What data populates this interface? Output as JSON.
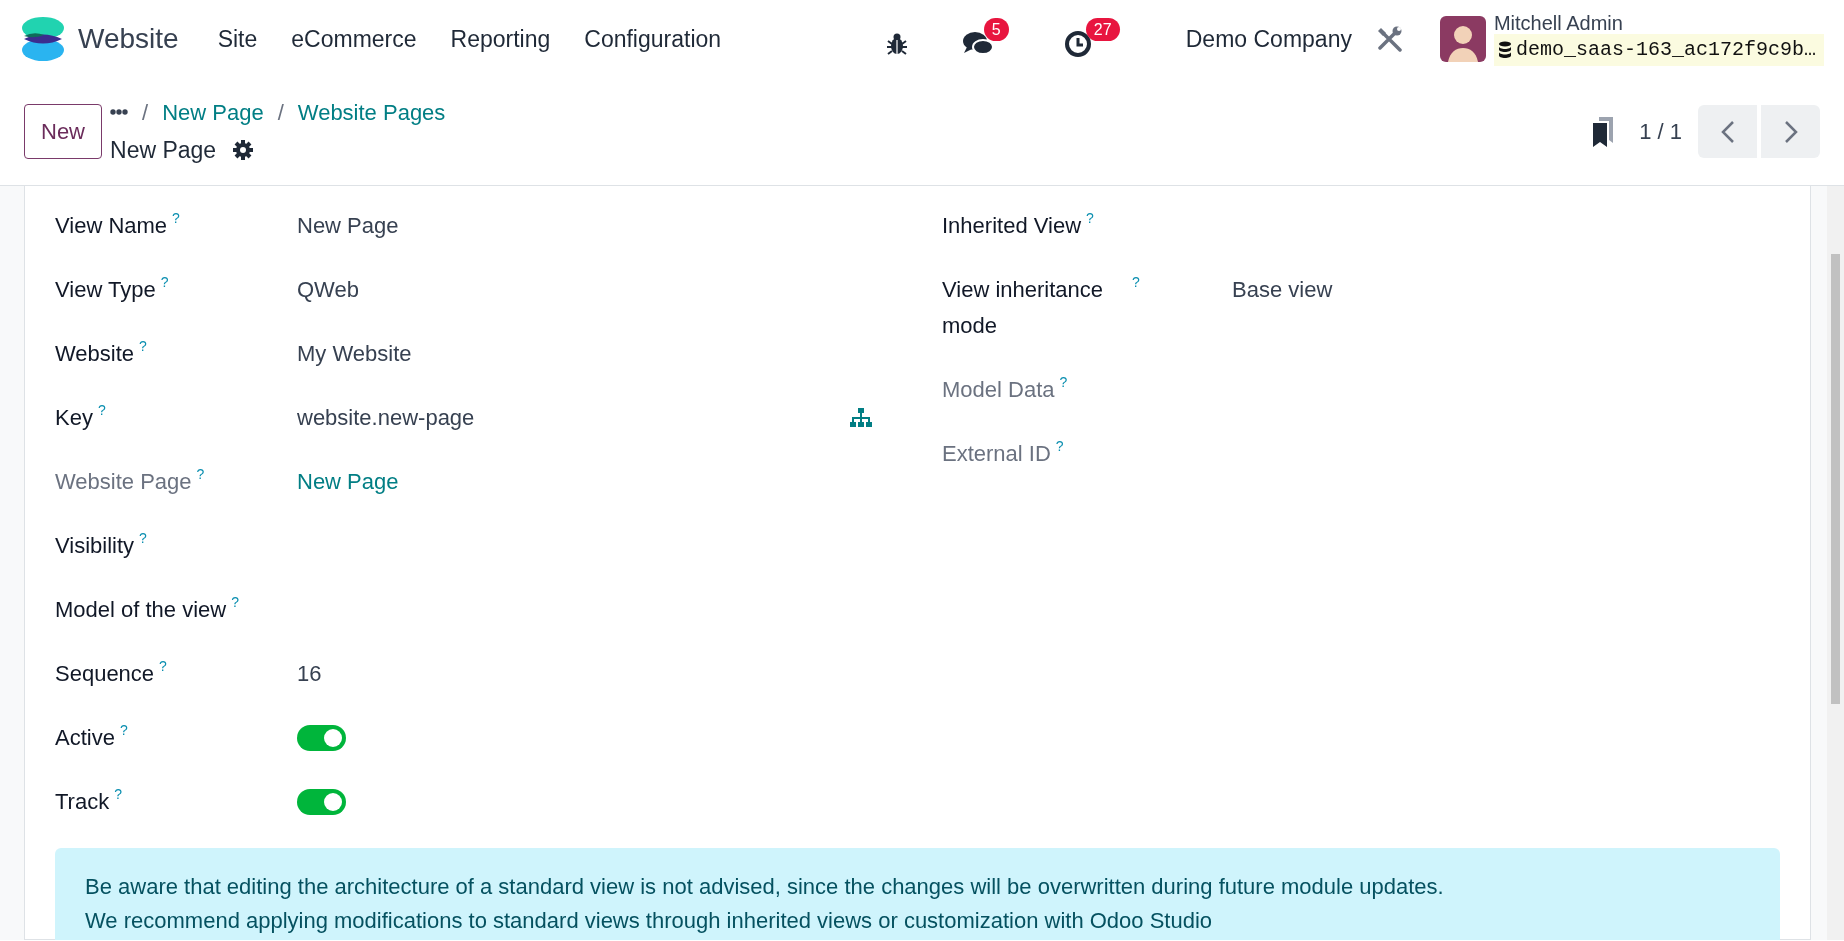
{
  "navbar": {
    "app_name": "Website",
    "menu": [
      "Site",
      "eCommerce",
      "Reporting",
      "Configuration"
    ],
    "messages_badge": "5",
    "activities_badge": "27",
    "company": "Demo Company",
    "user": {
      "name": "Mitchell Admin",
      "database": "demo_saas-163_ac172f9c9b…"
    }
  },
  "control_panel": {
    "new_button": "New",
    "breadcrumb_separator": "/",
    "breadcrumbs": [
      "New Page",
      "Website Pages"
    ],
    "title": "New Page",
    "pager": "1 / 1"
  },
  "form": {
    "left_fields": [
      {
        "label": "View Name",
        "help": "?",
        "muted": false,
        "kind": "text",
        "value": "New Page"
      },
      {
        "label": "View Type",
        "help": "?",
        "muted": false,
        "kind": "text",
        "value": "QWeb"
      },
      {
        "label": "Website",
        "help": "?",
        "muted": false,
        "kind": "text",
        "value": "My Website"
      },
      {
        "label": "Key",
        "help": "?",
        "muted": false,
        "kind": "text",
        "value": "website.new-page",
        "action_icon": true
      },
      {
        "label": "Website Page",
        "help": "?",
        "muted": true,
        "kind": "link",
        "value": "New Page"
      },
      {
        "label": "Visibility",
        "help": "?",
        "muted": false,
        "kind": "empty"
      },
      {
        "label": "Model of the view",
        "help": "?",
        "muted": false,
        "kind": "empty"
      },
      {
        "label": "Sequence",
        "help": "?",
        "muted": false,
        "kind": "text",
        "value": "16"
      },
      {
        "label": "Active",
        "help": "?",
        "muted": false,
        "kind": "toggle",
        "on": true
      },
      {
        "label": "Track",
        "help": "?",
        "muted": false,
        "kind": "toggle",
        "on": true
      }
    ],
    "right_fields": [
      {
        "label": "Inherited View",
        "help": "?",
        "muted": false,
        "kind": "empty"
      },
      {
        "label": "View inheritance mode",
        "help": "?",
        "muted": false,
        "kind": "text",
        "value": "Base view"
      },
      {
        "label": "Model Data",
        "help": "?",
        "muted": true,
        "kind": "empty"
      },
      {
        "label": "External ID",
        "help": "?",
        "muted": true,
        "kind": "empty"
      }
    ],
    "alert": [
      "Be aware that editing the architecture of a standard view is not advised, since the changes will be overwritten during future module updates.",
      "We recommend applying modifications to standard views through inherited views or customization with Odoo Studio"
    ]
  }
}
